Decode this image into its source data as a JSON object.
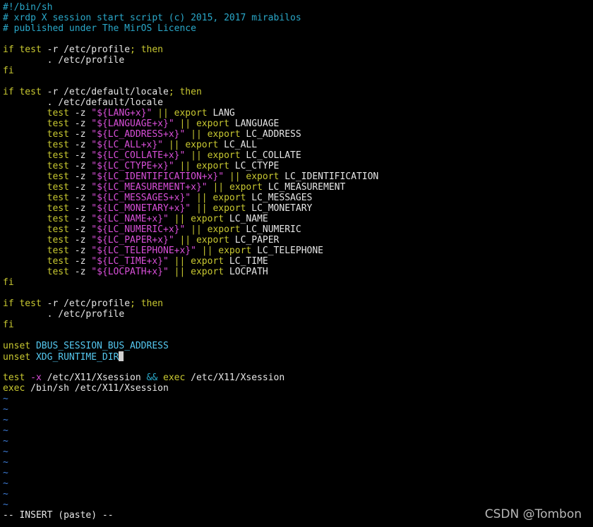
{
  "colors": {
    "background": "#000000",
    "default": "#e6e6e6",
    "comment": "#2aa8c9",
    "keyword": "#c9c931",
    "string": "#d94fd9",
    "variable": "#55c8f0",
    "operator": "#2aa8c9",
    "flag": "#d94fd9",
    "tilde": "#3d7bd6"
  },
  "buffer": {
    "lines": [
      [
        {
          "t": "#!/bin/sh",
          "c": "comment"
        }
      ],
      [
        {
          "t": "# xrdp X session start script (c) 2015, 2017 mirabilos",
          "c": "comment"
        }
      ],
      [
        {
          "t": "# published under The MirOS Licence",
          "c": "comment"
        }
      ],
      [],
      [
        {
          "t": "if",
          "c": "keyword"
        },
        {
          "t": " ",
          "c": "default"
        },
        {
          "t": "test",
          "c": "keyword"
        },
        {
          "t": " -r /etc/profile",
          "c": "default"
        },
        {
          "t": ";",
          "c": "keyword"
        },
        {
          "t": " ",
          "c": "default"
        },
        {
          "t": "then",
          "c": "keyword"
        }
      ],
      [
        {
          "t": "        . /etc/profile",
          "c": "default"
        }
      ],
      [
        {
          "t": "fi",
          "c": "keyword"
        }
      ],
      [],
      [
        {
          "t": "if",
          "c": "keyword"
        },
        {
          "t": " ",
          "c": "default"
        },
        {
          "t": "test",
          "c": "keyword"
        },
        {
          "t": " -r /etc/default/locale",
          "c": "default"
        },
        {
          "t": ";",
          "c": "keyword"
        },
        {
          "t": " ",
          "c": "default"
        },
        {
          "t": "then",
          "c": "keyword"
        }
      ],
      [
        {
          "t": "        . /etc/default/locale",
          "c": "default"
        }
      ],
      [
        {
          "t": "        ",
          "c": "default"
        },
        {
          "t": "test",
          "c": "keyword"
        },
        {
          "t": " -z ",
          "c": "default"
        },
        {
          "t": "\"${LANG+x}\"",
          "c": "string"
        },
        {
          "t": " || ",
          "c": "keyword"
        },
        {
          "t": "export",
          "c": "keyword"
        },
        {
          "t": " LANG",
          "c": "default"
        }
      ],
      [
        {
          "t": "        ",
          "c": "default"
        },
        {
          "t": "test",
          "c": "keyword"
        },
        {
          "t": " -z ",
          "c": "default"
        },
        {
          "t": "\"${LANGUAGE+x}\"",
          "c": "string"
        },
        {
          "t": " || ",
          "c": "keyword"
        },
        {
          "t": "export",
          "c": "keyword"
        },
        {
          "t": " LANGUAGE",
          "c": "default"
        }
      ],
      [
        {
          "t": "        ",
          "c": "default"
        },
        {
          "t": "test",
          "c": "keyword"
        },
        {
          "t": " -z ",
          "c": "default"
        },
        {
          "t": "\"${LC_ADDRESS+x}\"",
          "c": "string"
        },
        {
          "t": " || ",
          "c": "keyword"
        },
        {
          "t": "export",
          "c": "keyword"
        },
        {
          "t": " LC_ADDRESS",
          "c": "default"
        }
      ],
      [
        {
          "t": "        ",
          "c": "default"
        },
        {
          "t": "test",
          "c": "keyword"
        },
        {
          "t": " -z ",
          "c": "default"
        },
        {
          "t": "\"${LC_ALL+x}\"",
          "c": "string"
        },
        {
          "t": " || ",
          "c": "keyword"
        },
        {
          "t": "export",
          "c": "keyword"
        },
        {
          "t": " LC_ALL",
          "c": "default"
        }
      ],
      [
        {
          "t": "        ",
          "c": "default"
        },
        {
          "t": "test",
          "c": "keyword"
        },
        {
          "t": " -z ",
          "c": "default"
        },
        {
          "t": "\"${LC_COLLATE+x}\"",
          "c": "string"
        },
        {
          "t": " || ",
          "c": "keyword"
        },
        {
          "t": "export",
          "c": "keyword"
        },
        {
          "t": " LC_COLLATE",
          "c": "default"
        }
      ],
      [
        {
          "t": "        ",
          "c": "default"
        },
        {
          "t": "test",
          "c": "keyword"
        },
        {
          "t": " -z ",
          "c": "default"
        },
        {
          "t": "\"${LC_CTYPE+x}\"",
          "c": "string"
        },
        {
          "t": " || ",
          "c": "keyword"
        },
        {
          "t": "export",
          "c": "keyword"
        },
        {
          "t": " LC_CTYPE",
          "c": "default"
        }
      ],
      [
        {
          "t": "        ",
          "c": "default"
        },
        {
          "t": "test",
          "c": "keyword"
        },
        {
          "t": " -z ",
          "c": "default"
        },
        {
          "t": "\"${LC_IDENTIFICATION+x}\"",
          "c": "string"
        },
        {
          "t": " || ",
          "c": "keyword"
        },
        {
          "t": "export",
          "c": "keyword"
        },
        {
          "t": " LC_IDENTIFICATION",
          "c": "default"
        }
      ],
      [
        {
          "t": "        ",
          "c": "default"
        },
        {
          "t": "test",
          "c": "keyword"
        },
        {
          "t": " -z ",
          "c": "default"
        },
        {
          "t": "\"${LC_MEASUREMENT+x}\"",
          "c": "string"
        },
        {
          "t": " || ",
          "c": "keyword"
        },
        {
          "t": "export",
          "c": "keyword"
        },
        {
          "t": " LC_MEASUREMENT",
          "c": "default"
        }
      ],
      [
        {
          "t": "        ",
          "c": "default"
        },
        {
          "t": "test",
          "c": "keyword"
        },
        {
          "t": " -z ",
          "c": "default"
        },
        {
          "t": "\"${LC_MESSAGES+x}\"",
          "c": "string"
        },
        {
          "t": " || ",
          "c": "keyword"
        },
        {
          "t": "export",
          "c": "keyword"
        },
        {
          "t": " LC_MESSAGES",
          "c": "default"
        }
      ],
      [
        {
          "t": "        ",
          "c": "default"
        },
        {
          "t": "test",
          "c": "keyword"
        },
        {
          "t": " -z ",
          "c": "default"
        },
        {
          "t": "\"${LC_MONETARY+x}\"",
          "c": "string"
        },
        {
          "t": " || ",
          "c": "keyword"
        },
        {
          "t": "export",
          "c": "keyword"
        },
        {
          "t": " LC_MONETARY",
          "c": "default"
        }
      ],
      [
        {
          "t": "        ",
          "c": "default"
        },
        {
          "t": "test",
          "c": "keyword"
        },
        {
          "t": " -z ",
          "c": "default"
        },
        {
          "t": "\"${LC_NAME+x}\"",
          "c": "string"
        },
        {
          "t": " || ",
          "c": "keyword"
        },
        {
          "t": "export",
          "c": "keyword"
        },
        {
          "t": " LC_NAME",
          "c": "default"
        }
      ],
      [
        {
          "t": "        ",
          "c": "default"
        },
        {
          "t": "test",
          "c": "keyword"
        },
        {
          "t": " -z ",
          "c": "default"
        },
        {
          "t": "\"${LC_NUMERIC+x}\"",
          "c": "string"
        },
        {
          "t": " || ",
          "c": "keyword"
        },
        {
          "t": "export",
          "c": "keyword"
        },
        {
          "t": " LC_NUMERIC",
          "c": "default"
        }
      ],
      [
        {
          "t": "        ",
          "c": "default"
        },
        {
          "t": "test",
          "c": "keyword"
        },
        {
          "t": " -z ",
          "c": "default"
        },
        {
          "t": "\"${LC_PAPER+x}\"",
          "c": "string"
        },
        {
          "t": " || ",
          "c": "keyword"
        },
        {
          "t": "export",
          "c": "keyword"
        },
        {
          "t": " LC_PAPER",
          "c": "default"
        }
      ],
      [
        {
          "t": "        ",
          "c": "default"
        },
        {
          "t": "test",
          "c": "keyword"
        },
        {
          "t": " -z ",
          "c": "default"
        },
        {
          "t": "\"${LC_TELEPHONE+x}\"",
          "c": "string"
        },
        {
          "t": " || ",
          "c": "keyword"
        },
        {
          "t": "export",
          "c": "keyword"
        },
        {
          "t": " LC_TELEPHONE",
          "c": "default"
        }
      ],
      [
        {
          "t": "        ",
          "c": "default"
        },
        {
          "t": "test",
          "c": "keyword"
        },
        {
          "t": " -z ",
          "c": "default"
        },
        {
          "t": "\"${LC_TIME+x}\"",
          "c": "string"
        },
        {
          "t": " || ",
          "c": "keyword"
        },
        {
          "t": "export",
          "c": "keyword"
        },
        {
          "t": " LC_TIME",
          "c": "default"
        }
      ],
      [
        {
          "t": "        ",
          "c": "default"
        },
        {
          "t": "test",
          "c": "keyword"
        },
        {
          "t": " -z ",
          "c": "default"
        },
        {
          "t": "\"${LOCPATH+x}\"",
          "c": "string"
        },
        {
          "t": " || ",
          "c": "keyword"
        },
        {
          "t": "export",
          "c": "keyword"
        },
        {
          "t": " LOCPATH",
          "c": "default"
        }
      ],
      [
        {
          "t": "fi",
          "c": "keyword"
        }
      ],
      [],
      [
        {
          "t": "if",
          "c": "keyword"
        },
        {
          "t": " ",
          "c": "default"
        },
        {
          "t": "test",
          "c": "keyword"
        },
        {
          "t": " -r /etc/profile",
          "c": "default"
        },
        {
          "t": ";",
          "c": "keyword"
        },
        {
          "t": " ",
          "c": "default"
        },
        {
          "t": "then",
          "c": "keyword"
        }
      ],
      [
        {
          "t": "        . /etc/profile",
          "c": "default"
        }
      ],
      [
        {
          "t": "fi",
          "c": "keyword"
        }
      ],
      [],
      [
        {
          "t": "unset",
          "c": "keyword"
        },
        {
          "t": " ",
          "c": "default"
        },
        {
          "t": "DBUS_SESSION_BUS_ADDRESS",
          "c": "variable"
        }
      ],
      [
        {
          "t": "unset",
          "c": "keyword"
        },
        {
          "t": " ",
          "c": "default"
        },
        {
          "t": "XDG_RUNTIME_DIR",
          "c": "variable"
        },
        {
          "cursor": true
        }
      ],
      [],
      [
        {
          "t": "test",
          "c": "keyword"
        },
        {
          "t": " ",
          "c": "default"
        },
        {
          "t": "-x",
          "c": "flag"
        },
        {
          "t": " /etc/X11/Xsession ",
          "c": "default"
        },
        {
          "t": "&&",
          "c": "operator"
        },
        {
          "t": " ",
          "c": "default"
        },
        {
          "t": "exec",
          "c": "keyword"
        },
        {
          "t": " /etc/X11/Xsession",
          "c": "default"
        }
      ],
      [
        {
          "t": "exec",
          "c": "keyword"
        },
        {
          "t": " /bin/sh /etc/X11/Xsession",
          "c": "default"
        }
      ]
    ],
    "empty_line_marker": "~",
    "empty_line_count": 11
  },
  "status": {
    "mode_text": "-- INSERT (paste) --"
  },
  "watermark": {
    "text": "CSDN @Tombon"
  }
}
